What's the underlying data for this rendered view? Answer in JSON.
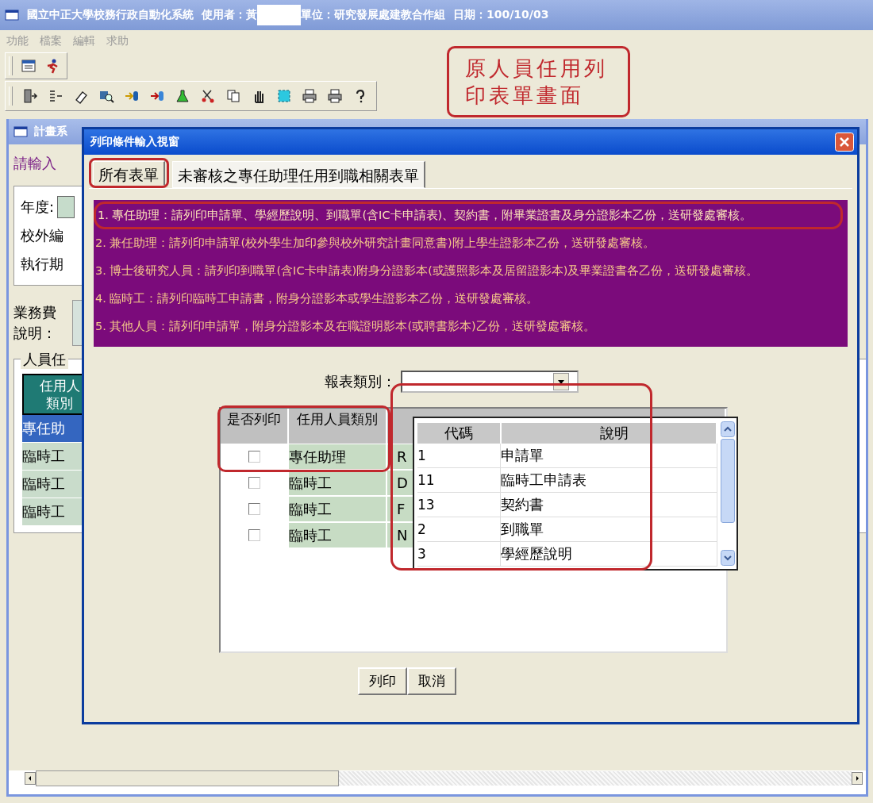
{
  "window": {
    "title": "國立中正大學校務行政自動化系統",
    "user": "使用者：黃",
    "unit": "單位：研究發展處建教合作組",
    "date": "日期：100/10/03"
  },
  "menu": [
    {
      "label": "功能",
      "disabled": true
    },
    {
      "label": "檔案",
      "disabled": true
    },
    {
      "label": "編輯",
      "disabled": true
    },
    {
      "label": "求助",
      "disabled": true
    }
  ],
  "annotation": {
    "text": "原人員任用列印表單畫面"
  },
  "background_window": {
    "title": "計畫系",
    "prompt": "請輸入",
    "fields": [
      {
        "label": "年度:",
        "kind": "input"
      },
      {
        "label": "校外編",
        "kind": "label"
      },
      {
        "label": "執行期",
        "kind": "label"
      }
    ],
    "expense_label": "業務費說明：",
    "group_label": "人員任",
    "grid": {
      "header": "任用人類別",
      "rows": [
        {
          "text": "專任助",
          "selected": true
        },
        {
          "text": "臨時工",
          "selected": false
        },
        {
          "text": "臨時工",
          "selected": false
        },
        {
          "text": "臨時工",
          "selected": false
        }
      ]
    }
  },
  "dialog": {
    "title": "列印條件輸入視窗",
    "tabs": [
      {
        "label": "所有表單",
        "selected": true
      },
      {
        "label": "未審核之專任助理任用到職相關表單",
        "selected": false
      }
    ],
    "notes": [
      "1. 專任助理：請列印申請單、學經歷說明、到職單(含IC卡申請表)、契約書，附畢業證書及身分證影本乙份，送研發處審核。",
      "2. 兼任助理：請列印申請單(校外學生加印參與校外研究計畫同意書)附上學生證影本乙份，送研發處審核。",
      "3. 博士後研究人員：請列印到職單(含IC卡申請表)附身分證影本(或護照影本及居留證影本)及畢業證書各乙份，送研發處審核。",
      "4. 臨時工：請列印臨時工申請書，附身分證影本或學生證影本乙份，送研發處審核。",
      "5. 其他人員：請列印申請單，附身分證影本及在職證明影本(或聘書影本)乙份，送研發處審核。"
    ],
    "report_type": {
      "label": "報表類別：",
      "expanded": true
    },
    "dropdown": {
      "columns": [
        "代碼",
        "說明"
      ],
      "rows": [
        {
          "code": "1",
          "description": "申請單"
        },
        {
          "code": "11",
          "description": "臨時工申請表"
        },
        {
          "code": "13",
          "description": "契約書"
        },
        {
          "code": "2",
          "description": "到職單"
        },
        {
          "code": "3",
          "description": "學經歷說明"
        }
      ]
    },
    "grid": {
      "columns": [
        "是否列印",
        "任用人員類別"
      ],
      "rows": [
        {
          "checked": false,
          "type": "專任助理",
          "column_3": "R"
        },
        {
          "checked": false,
          "type": "臨時工",
          "column_3": "D"
        },
        {
          "checked": false,
          "type": "臨時工",
          "column_3": "F"
        },
        {
          "checked": false,
          "type": "臨時工",
          "column_3": "N"
        }
      ]
    },
    "buttons": [
      "列印",
      "取消"
    ]
  }
}
